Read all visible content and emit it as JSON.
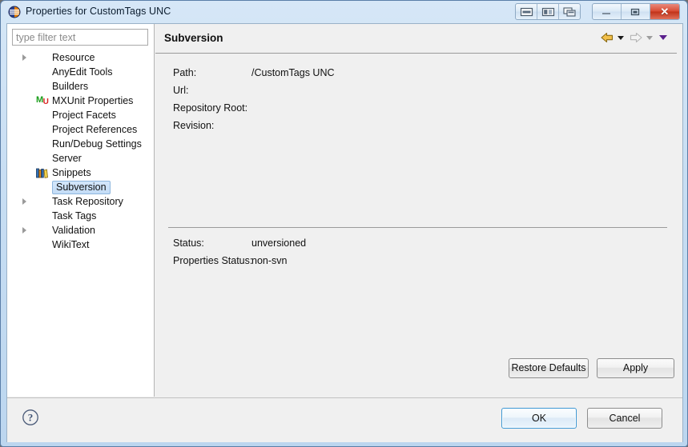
{
  "window": {
    "title": "Properties for CustomTags UNC",
    "app_icon": "eclipse-icon",
    "arrange_buttons": [
      {
        "name": "restore-layout-button",
        "icon": "window-layout-icon"
      },
      {
        "name": "split-layout-button",
        "icon": "window-split-icon"
      },
      {
        "name": "cascade-layout-button",
        "icon": "window-cascade-icon"
      }
    ],
    "minimize_label": "",
    "maximize_label": "",
    "close_label": "✕"
  },
  "sidebar": {
    "filter": {
      "placeholder": "type filter text",
      "value": ""
    },
    "items": [
      {
        "label": "Resource",
        "expandable": true,
        "icon": null,
        "selected": false
      },
      {
        "label": "AnyEdit Tools",
        "expandable": false,
        "icon": null,
        "selected": false
      },
      {
        "label": "Builders",
        "expandable": false,
        "icon": null,
        "selected": false
      },
      {
        "label": "MXUnit Properties",
        "expandable": false,
        "icon": "mxunit-icon",
        "selected": false
      },
      {
        "label": "Project Facets",
        "expandable": false,
        "icon": null,
        "selected": false
      },
      {
        "label": "Project References",
        "expandable": false,
        "icon": null,
        "selected": false
      },
      {
        "label": "Run/Debug Settings",
        "expandable": false,
        "icon": null,
        "selected": false
      },
      {
        "label": "Server",
        "expandable": false,
        "icon": null,
        "selected": false
      },
      {
        "label": "Snippets",
        "expandable": false,
        "icon": "snippets-books-icon",
        "selected": false
      },
      {
        "label": "Subversion",
        "expandable": false,
        "icon": null,
        "selected": true
      },
      {
        "label": "Task Repository",
        "expandable": true,
        "icon": null,
        "selected": false
      },
      {
        "label": "Task Tags",
        "expandable": false,
        "icon": null,
        "selected": false
      },
      {
        "label": "Validation",
        "expandable": true,
        "icon": null,
        "selected": false
      },
      {
        "label": "WikiText",
        "expandable": false,
        "icon": null,
        "selected": false
      }
    ]
  },
  "content": {
    "page_title": "Subversion",
    "nav": {
      "back_icon": "back-arrow-icon",
      "back_menu_icon": "chevron-down-icon",
      "forward_icon": "forward-arrow-icon",
      "forward_menu_icon": "chevron-down-icon",
      "page_menu_icon": "chevron-down-purple-icon"
    },
    "info_fields": [
      {
        "label": "Path:",
        "value": "/CustomTags UNC"
      },
      {
        "label": "Url:",
        "value": ""
      },
      {
        "label": "Repository Root:",
        "value": ""
      },
      {
        "label": "Revision:",
        "value": ""
      }
    ],
    "status_fields": [
      {
        "label": "Status:",
        "value": "unversioned"
      },
      {
        "label": "Properties Status:",
        "value": "non-svn"
      }
    ],
    "restore_defaults_label": "Restore Defaults",
    "apply_label": "Apply"
  },
  "footer": {
    "help_icon": "help-question-icon",
    "ok_label": "OK",
    "cancel_label": "Cancel"
  },
  "colors": {
    "titlebar": "#c8def3",
    "selection": "#c3dcf6",
    "selection_border": "#8fb7de",
    "close_button": "#c03219",
    "focus_border": "#3d97d4",
    "back_arrow": "#e8a020",
    "forward_arrow": "#bdbdbd",
    "purple_caret": "#5a1f8c"
  }
}
